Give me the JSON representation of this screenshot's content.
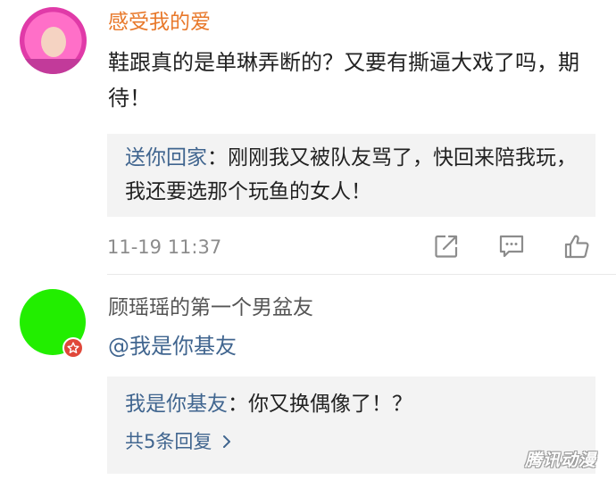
{
  "comment1": {
    "username": "感受我的爱",
    "text": "鞋跟真的是单琳弄断的？又要有撕逼大戏了吗，期待！",
    "quote": {
      "user": "送你回家",
      "separator": "：",
      "text": "刚刚我又被队友骂了，快回来陪我玩，我还要选那个玩鱼的女人！"
    },
    "time": "11-19 11:37",
    "icons": {
      "share": "share-icon",
      "comment": "comment-icon",
      "like": "thumbs-up-icon"
    }
  },
  "comment2": {
    "username": "顾瑶瑶的第一个男盆友",
    "text": "@我是你基友",
    "quote": {
      "user": "我是你基友",
      "separator": "：",
      "text": "你又换偶像了！？"
    },
    "more_replies": "共5条回复",
    "badge_icon": "star-badge-icon"
  },
  "watermark": "腾讯动漫",
  "colors": {
    "username_highlight": "#e8782a",
    "link_blue": "#40658f",
    "quote_bg": "#f3f3f3",
    "avatar_green": "#22ee00",
    "badge_red": "#e0483a",
    "meta_gray": "#8c8c8c"
  }
}
